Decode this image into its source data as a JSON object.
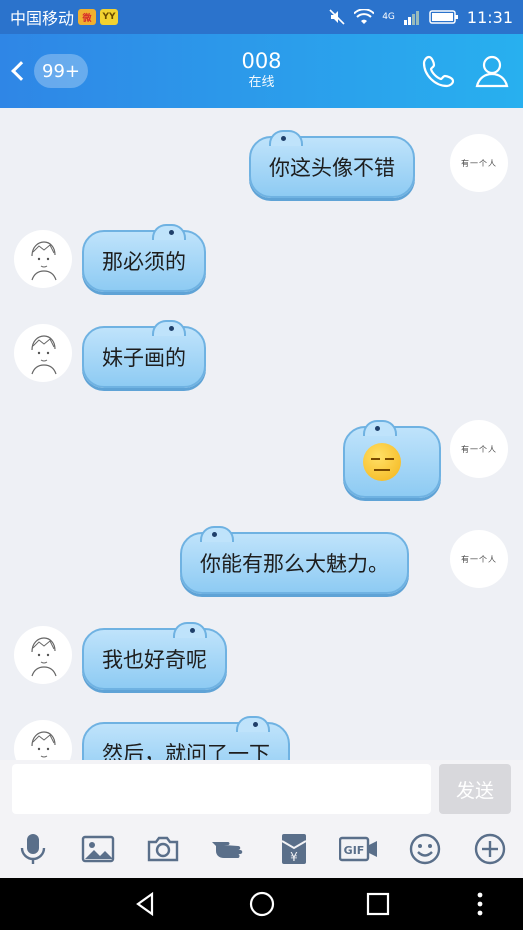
{
  "status_bar": {
    "carrier": "中国移动",
    "weibo_badge": "微",
    "yy_badge": "YY",
    "network": "4G",
    "time": "11:31"
  },
  "header": {
    "unread_count": "99+",
    "contact_name": "008",
    "status": "在线"
  },
  "avatars": {
    "self_avatar_text": "有一个人"
  },
  "messages": [
    {
      "side": "right",
      "text": "你这头像不错"
    },
    {
      "side": "left",
      "text": "那必须的"
    },
    {
      "side": "left",
      "text": "妹子画的"
    },
    {
      "side": "right",
      "text": "",
      "emoji": "smirk-face-icon"
    },
    {
      "side": "right",
      "text": "你能有那么大魅力。"
    },
    {
      "side": "left",
      "text": "我也好奇呢"
    },
    {
      "side": "left",
      "text": "然后，就问了一下"
    }
  ],
  "input": {
    "value": "",
    "send_label": "发送"
  },
  "toolbar_icons": [
    "microphone-icon",
    "image-icon",
    "camera-icon",
    "red-packet-hand-icon",
    "money-envelope-icon",
    "gif-icon",
    "smiley-icon",
    "plus-circle-icon"
  ],
  "colors": {
    "header_start": "#2f86e6",
    "header_end": "#28b0ef",
    "bubble": "#9fd4f6",
    "toolbar_icon": "#5a6f8a"
  }
}
